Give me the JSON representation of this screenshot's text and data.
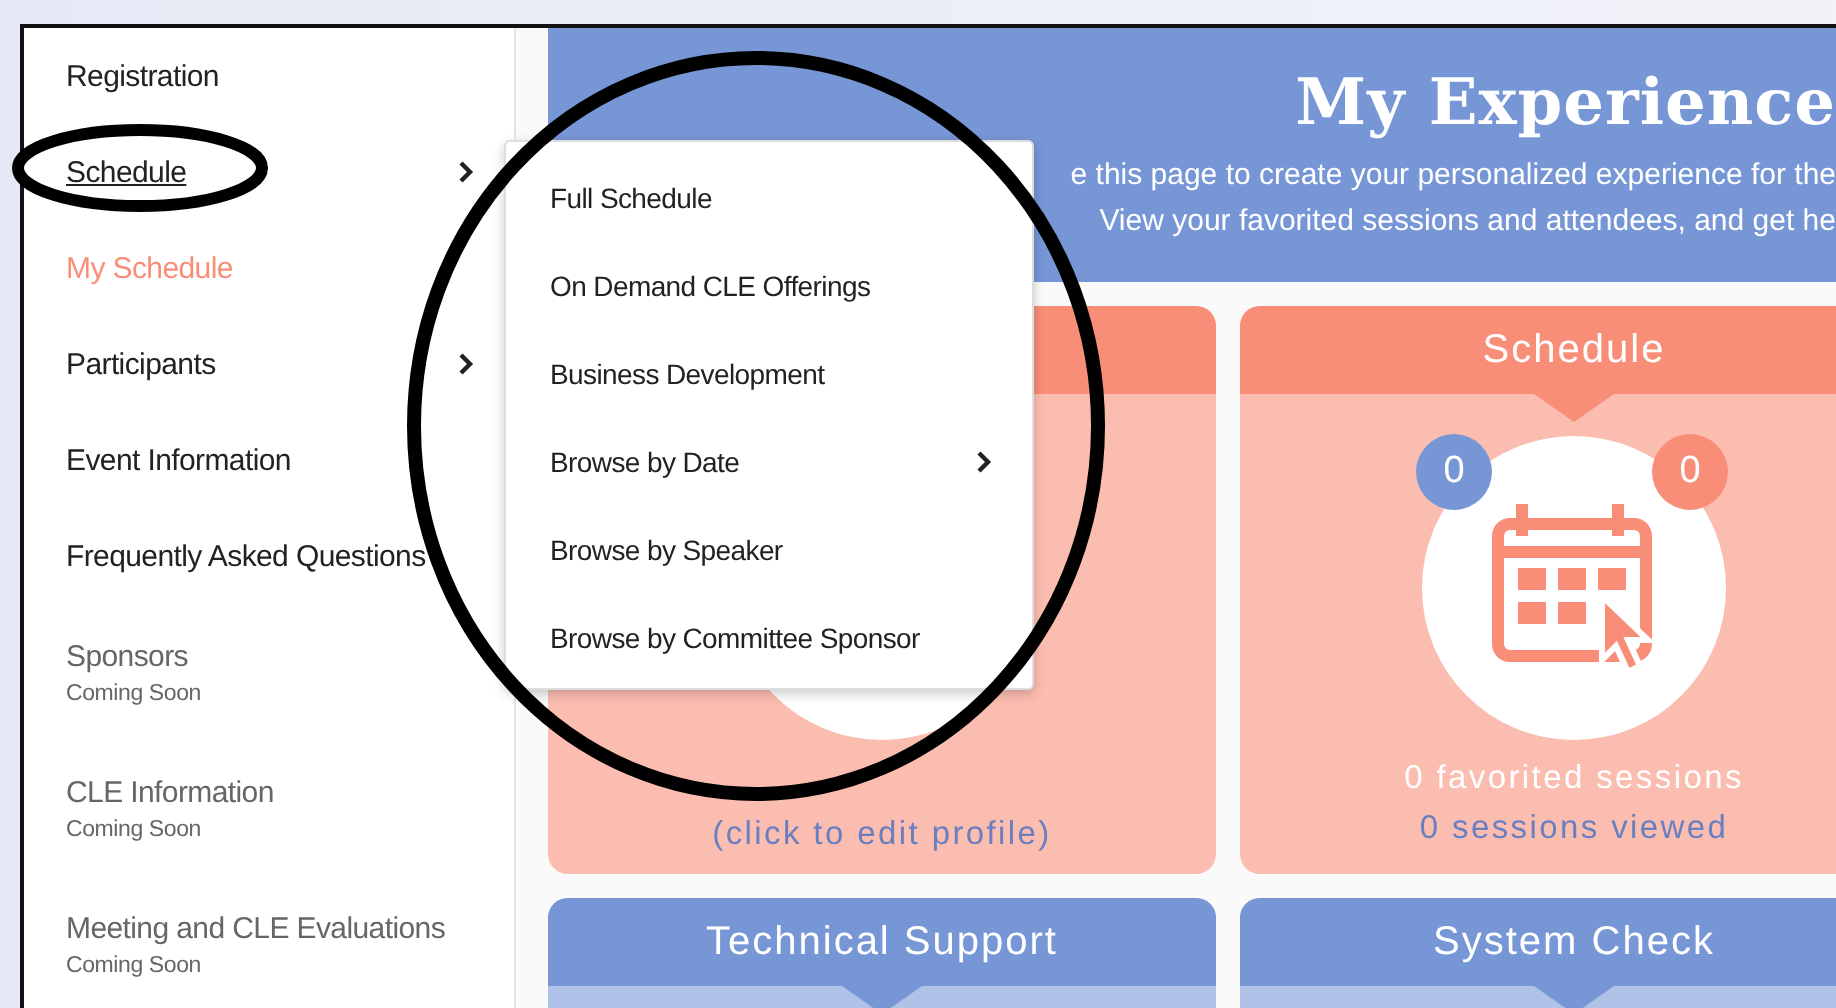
{
  "sidebar": {
    "items": [
      {
        "label": "Registration",
        "selected": false,
        "expanded": false,
        "disabled": false,
        "has_submenu": false
      },
      {
        "label": "Schedule",
        "selected": false,
        "expanded": true,
        "disabled": false,
        "has_submenu": true
      },
      {
        "label": "My Schedule",
        "selected": true,
        "expanded": false,
        "disabled": false,
        "has_submenu": false
      },
      {
        "label": "Participants",
        "selected": false,
        "expanded": false,
        "disabled": false,
        "has_submenu": true
      },
      {
        "label": "Event Information",
        "selected": false,
        "expanded": false,
        "disabled": false,
        "has_submenu": false
      },
      {
        "label": "Frequently Asked Questions",
        "selected": false,
        "expanded": false,
        "disabled": false,
        "has_submenu": false
      },
      {
        "label": "Sponsors",
        "note": "Coming Soon",
        "selected": false,
        "expanded": false,
        "disabled": true,
        "has_submenu": false
      },
      {
        "label": "CLE Information",
        "note": "Coming Soon",
        "selected": false,
        "expanded": false,
        "disabled": true,
        "has_submenu": false
      },
      {
        "label": "Meeting and CLE Evaluations",
        "note": "Coming Soon",
        "selected": false,
        "expanded": false,
        "disabled": true,
        "has_submenu": false
      }
    ]
  },
  "submenu": {
    "items": [
      {
        "label": "Full Schedule",
        "has_submenu": false
      },
      {
        "label": "On Demand CLE Offerings",
        "has_submenu": false
      },
      {
        "label": "Business Development",
        "has_submenu": false
      },
      {
        "label": "Browse by Date",
        "has_submenu": true
      },
      {
        "label": "Browse by Speaker",
        "has_submenu": false
      },
      {
        "label": "Browse by Committee Sponsor",
        "has_submenu": false
      }
    ]
  },
  "banner": {
    "title": "My Experience",
    "lines": [
      "e this page to create your personalized experience for the",
      "View your favorited sessions and attendees, and get he"
    ]
  },
  "profile_card": {
    "color": "#f98e78",
    "caption": "(click to edit profile)"
  },
  "cards": [
    {
      "kind": "stats",
      "color": "#f98e78",
      "title": "Schedule",
      "badges": [
        {
          "text": "0",
          "color": "#7796d6"
        },
        {
          "text": "0",
          "color": "#f98e78"
        }
      ],
      "lines": [
        "0 favorited sessions",
        "0 sessions viewed"
      ]
    },
    {
      "kind": "link",
      "color": "#7796d6",
      "title": "Technical Support"
    },
    {
      "kind": "link",
      "color": "#7796d6",
      "title": "System Check"
    }
  ]
}
